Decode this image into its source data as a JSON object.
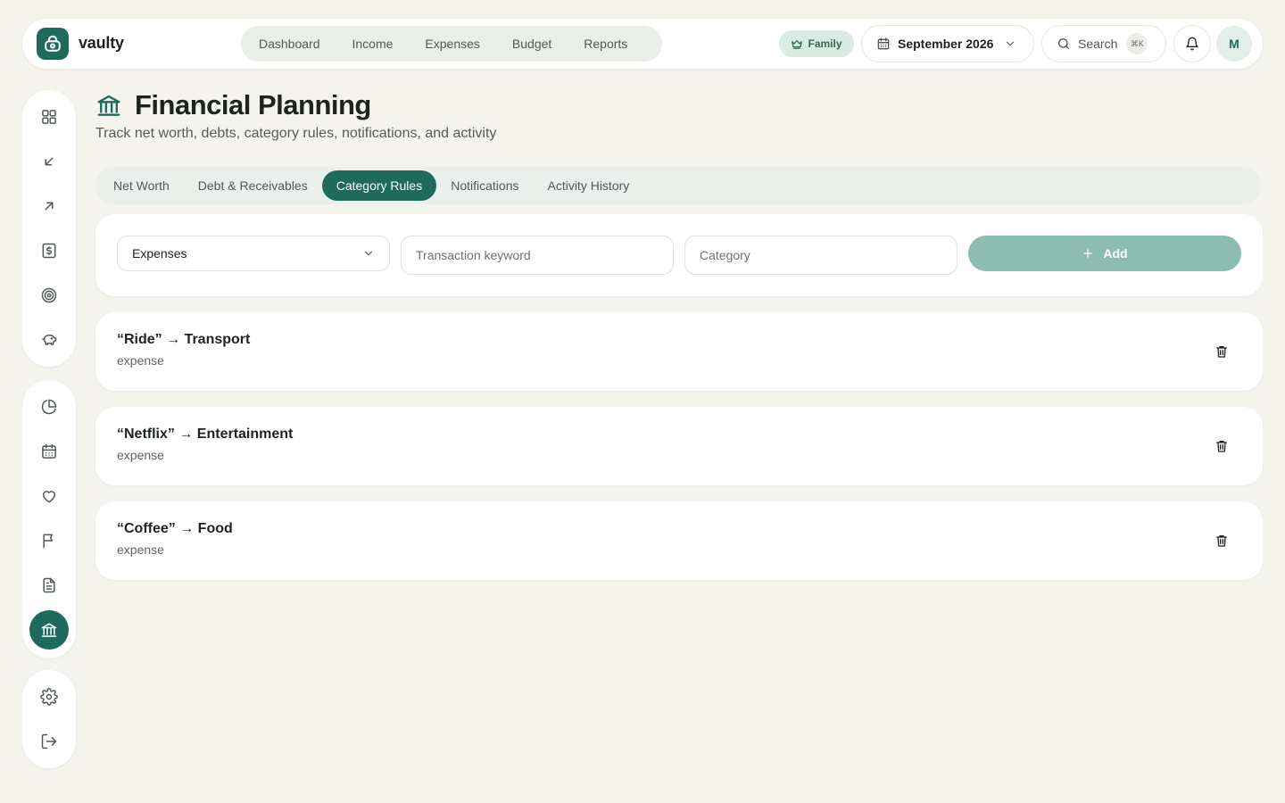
{
  "brand": {
    "name": "vaulty"
  },
  "nav": {
    "items": [
      {
        "label": "Dashboard"
      },
      {
        "label": "Income"
      },
      {
        "label": "Expenses"
      },
      {
        "label": "Budget"
      },
      {
        "label": "Reports"
      }
    ]
  },
  "header": {
    "plan_badge": "Family",
    "period": "September 2026",
    "search_label": "Search",
    "search_shortcut": "⌘K",
    "avatar_initial": "M"
  },
  "page": {
    "title": "Financial Planning",
    "subtitle": "Track net worth, debts, category rules, notifications, and activity"
  },
  "tabs": [
    {
      "label": "Net Worth",
      "active": false
    },
    {
      "label": "Debt & Receivables",
      "active": false
    },
    {
      "label": "Category Rules",
      "active": true
    },
    {
      "label": "Notifications",
      "active": false
    },
    {
      "label": "Activity History",
      "active": false
    }
  ],
  "rule_form": {
    "type_value": "Expenses",
    "keyword_placeholder": "Transaction keyword",
    "category_placeholder": "Category",
    "add_label": "Add"
  },
  "rules": [
    {
      "keyword": "Ride",
      "category": "Transport",
      "type": "expense",
      "display": "“Ride” → Transport"
    },
    {
      "keyword": "Netflix",
      "category": "Entertainment",
      "type": "expense",
      "display": "“Netflix” → Entertainment"
    },
    {
      "keyword": "Coffee",
      "category": "Food",
      "type": "expense",
      "display": "“Coffee” → Food"
    }
  ],
  "sidebar": {
    "items": [
      {
        "icon": "grid-icon"
      },
      {
        "icon": "arrow-down-left-icon"
      },
      {
        "icon": "arrow-up-right-icon"
      },
      {
        "icon": "dollar-receipt-icon"
      },
      {
        "icon": "target-icon"
      },
      {
        "icon": "piggy-bank-icon"
      },
      {
        "icon": "pie-chart-icon"
      },
      {
        "icon": "calendar-icon"
      },
      {
        "icon": "heart-icon"
      },
      {
        "icon": "flag-icon"
      },
      {
        "icon": "document-icon"
      },
      {
        "icon": "bank-icon",
        "active": true
      },
      {
        "icon": "gear-icon"
      },
      {
        "icon": "logout-icon"
      }
    ]
  },
  "colors": {
    "accent": "#1e6b5c",
    "accent_soft": "#8dbdb1",
    "background": "#f4f3ee",
    "badge_bg": "#d9ebe2"
  }
}
